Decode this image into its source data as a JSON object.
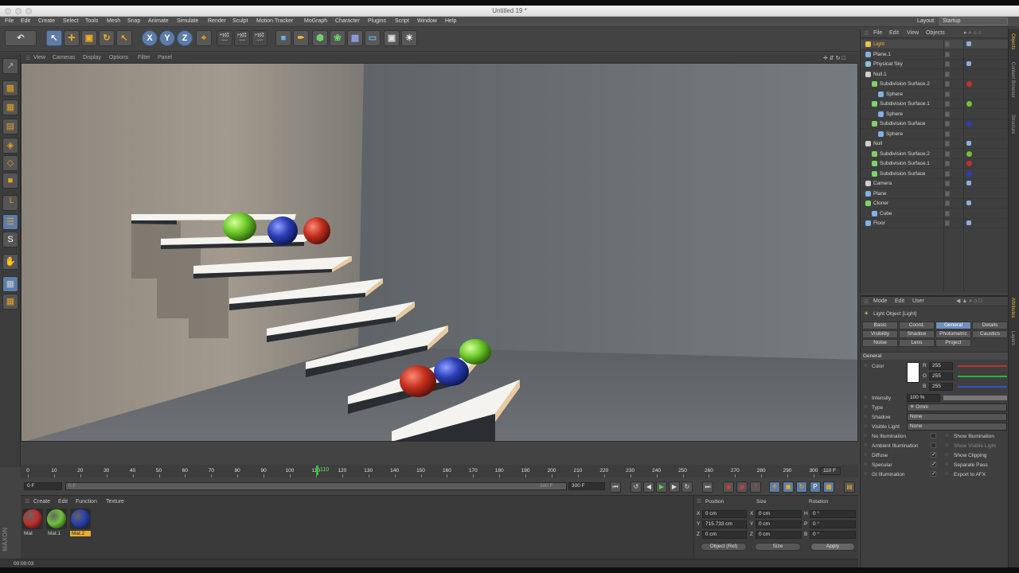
{
  "window": {
    "title": "Untitled 19 *"
  },
  "menu": [
    "File",
    "Edit",
    "Create",
    "Select",
    "Tools",
    "Mesh",
    "Snap",
    "Animate",
    "Simulate",
    "Render",
    "Sculpt",
    "Motion Tracker",
    "MoGraph",
    "Character",
    "Plugins",
    "Script",
    "Window",
    "Help"
  ],
  "layout": {
    "label": "Layout:",
    "value": "Startup"
  },
  "toolbar": {
    "axis_x": "X",
    "axis_y": "Y",
    "axis_z": "Z"
  },
  "viewport": {
    "menu": [
      "View",
      "Cameras",
      "Display",
      "Options",
      "Filter",
      "Panel"
    ]
  },
  "timeline": {
    "ticks": [
      "0",
      "10",
      "20",
      "30",
      "40",
      "50",
      "60",
      "70",
      "80",
      "90",
      "100",
      "110",
      "120",
      "130",
      "140",
      "150",
      "160",
      "170",
      "180",
      "190",
      "200",
      "210",
      "220",
      "230",
      "240",
      "250",
      "260",
      "270",
      "280",
      "290",
      "300"
    ],
    "current_frame": "110 F",
    "cursor_label": "110"
  },
  "playback": {
    "start": "0 F",
    "min": "0 F",
    "max": "300 F",
    "end": "300 F"
  },
  "materials": {
    "menu": [
      "Create",
      "Edit",
      "Function",
      "Texture"
    ],
    "items": [
      {
        "name": "Mat",
        "color": "#c0302a"
      },
      {
        "name": "Mat.1",
        "color": "#6fc23a"
      },
      {
        "name": "Mat.2",
        "color": "#2a3fb0"
      }
    ]
  },
  "coords": {
    "headers": [
      "Position",
      "Size",
      "Rotation"
    ],
    "rows": [
      {
        "pos_label": "X",
        "pos": "0 cm",
        "size_label": "X",
        "size": "0 cm",
        "rot_label": "H",
        "rot": "0 °"
      },
      {
        "pos_label": "Y",
        "pos": "715.733 cm",
        "size_label": "Y",
        "size": "0 cm",
        "rot_label": "P",
        "rot": "0 °"
      },
      {
        "pos_label": "Z",
        "pos": "0 cm",
        "size_label": "Z",
        "size": "0 cm",
        "rot_label": "B",
        "rot": "0 °"
      }
    ],
    "mode": "Object (Rel)",
    "size_mode": "Size",
    "apply": "Apply"
  },
  "status": {
    "time": "00:00:03"
  },
  "objects": {
    "menu": [
      "File",
      "Edit",
      "View",
      "Objects"
    ],
    "rows": [
      {
        "name": "Light",
        "indent": 0,
        "icon": "#e8c64a",
        "highlight": true
      },
      {
        "name": "Plane.1",
        "indent": 0,
        "icon": "#7fb3e6"
      },
      {
        "name": "Physical Sky",
        "indent": 0,
        "icon": "#8ac0e0"
      },
      {
        "name": "Null.1",
        "indent": 0,
        "icon": "#cfcfcf"
      },
      {
        "name": "Subdivision Surface.2",
        "indent": 1,
        "icon": "#7fd36a",
        "tag": "#c0302a"
      },
      {
        "name": "Sphere",
        "indent": 2,
        "icon": "#7fb3e6"
      },
      {
        "name": "Subdivision Surface.1",
        "indent": 1,
        "icon": "#7fd36a",
        "tag": "#6fc23a"
      },
      {
        "name": "Sphere",
        "indent": 2,
        "icon": "#7fb3e6"
      },
      {
        "name": "Subdivision Surface",
        "indent": 1,
        "icon": "#7fd36a",
        "tag": "#2a3fb0"
      },
      {
        "name": "Sphere",
        "indent": 2,
        "icon": "#7fb3e6"
      },
      {
        "name": "Null",
        "indent": 0,
        "icon": "#cfcfcf"
      },
      {
        "name": "Subdivision Surface.2",
        "indent": 1,
        "icon": "#7fd36a",
        "tag": "#6fc23a"
      },
      {
        "name": "Subdivision Surface.1",
        "indent": 1,
        "icon": "#7fd36a",
        "tag": "#c0302a"
      },
      {
        "name": "Subdivision Surface",
        "indent": 1,
        "icon": "#7fd36a",
        "tag": "#2a3fb0"
      },
      {
        "name": "Camera",
        "indent": 0,
        "icon": "#cfcfcf"
      },
      {
        "name": "Plane",
        "indent": 0,
        "icon": "#7fb3e6"
      },
      {
        "name": "Cloner",
        "indent": 0,
        "icon": "#7fd36a"
      },
      {
        "name": "Cube",
        "indent": 1,
        "icon": "#7fb3e6"
      },
      {
        "name": "Floor",
        "indent": 0,
        "icon": "#7fb3e6"
      }
    ]
  },
  "attributes": {
    "menu": [
      "Mode",
      "Edit",
      "User"
    ],
    "object_title": "Light Object [Light]",
    "tabs": [
      [
        "Basic",
        "Coord.",
        "General",
        "Details"
      ],
      [
        "Visibility",
        "Shadow",
        "Photometric",
        "Caustics"
      ],
      [
        "Noise",
        "Lens",
        "Project",
        ""
      ]
    ],
    "selected_tab": "General",
    "section": "General",
    "color_label": "Color",
    "rgb": [
      {
        "k": "R",
        "v": "255"
      },
      {
        "k": "G",
        "v": "255"
      },
      {
        "k": "B",
        "v": "255"
      }
    ],
    "intensity_label": "Intensity",
    "intensity": "100 %",
    "type_label": "Type",
    "type": "Omni",
    "shadow_label": "Shadow",
    "shadow": "None",
    "visible_light_label": "Visible Light",
    "visible_light": "None",
    "checks_left": [
      {
        "label": "No Illumination",
        "checked": false
      },
      {
        "label": "Ambient Illumination",
        "checked": false
      },
      {
        "label": "Diffuse",
        "checked": true
      },
      {
        "label": "Specular",
        "checked": true
      },
      {
        "label": "GI Illumination",
        "checked": true
      }
    ],
    "checks_right": [
      {
        "label": "Show Illumination",
        "checked": true
      },
      {
        "label": "Show Visible Light",
        "checked": true,
        "dim": true
      },
      {
        "label": "Show Clipping",
        "checked": true
      },
      {
        "label": "Separate Pass",
        "checked": false
      },
      {
        "label": "Export to AFX",
        "checked": true
      }
    ]
  },
  "side_tabs": [
    "Objects",
    "Content Browser",
    "Structure",
    "Attributes",
    "Layers"
  ]
}
